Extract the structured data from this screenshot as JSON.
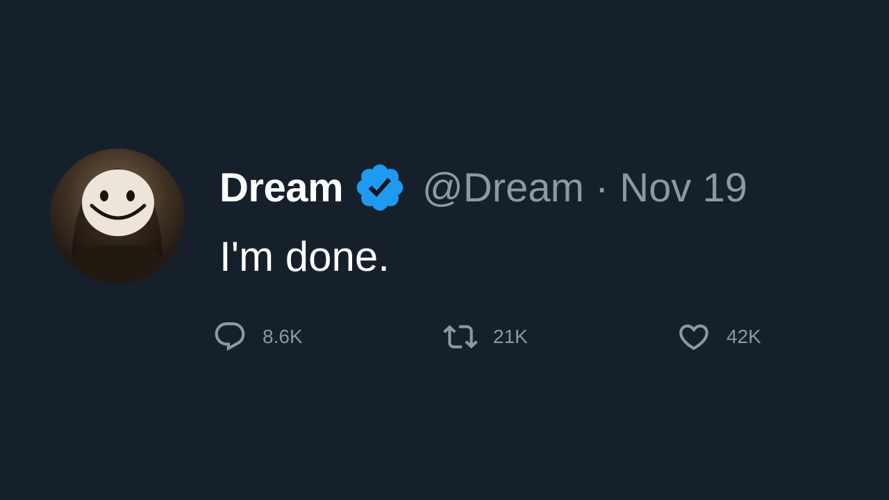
{
  "tweet": {
    "author_name": "Dream",
    "verified_icon": "verified-badge-icon",
    "handle": "@Dream",
    "separator": "·",
    "date": "Nov 19",
    "text": "I'm done."
  },
  "actions": {
    "reply": {
      "icon": "reply-icon",
      "count": "8.6K"
    },
    "retweet": {
      "icon": "retweet-icon",
      "count": "21K"
    },
    "like": {
      "icon": "heart-icon",
      "count": "42K"
    }
  },
  "colors": {
    "background": "#15202b",
    "primary_text": "#ffffff",
    "secondary_text": "#8b98a5",
    "verified": "#1d9bf0"
  }
}
